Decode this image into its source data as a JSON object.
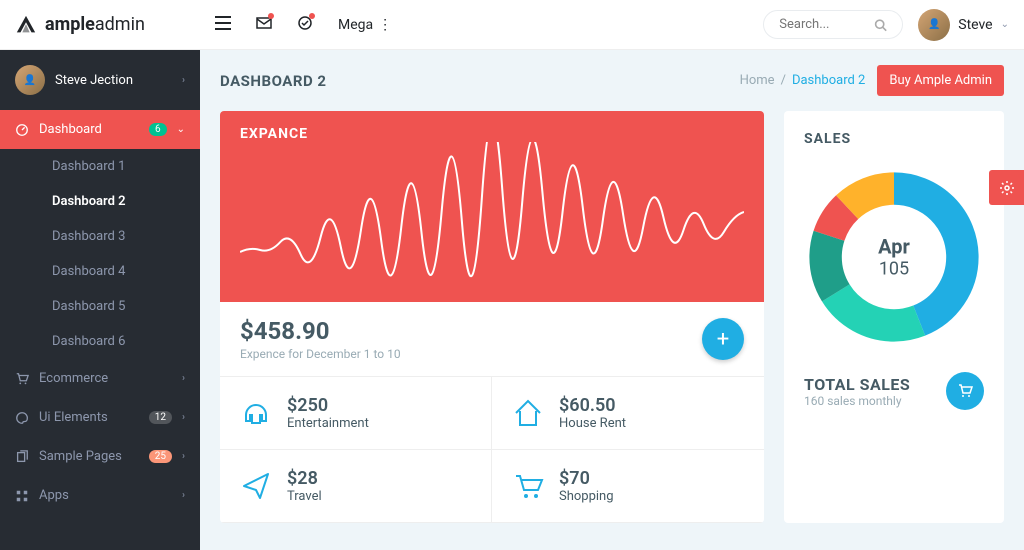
{
  "brand": {
    "bold": "ample",
    "light": "admin"
  },
  "topbar": {
    "mega_label": "Mega",
    "search_placeholder": "Search...",
    "user_name": "Steve"
  },
  "sidebar": {
    "user_name": "Steve Jection",
    "dashboard_label": "Dashboard",
    "dashboard_badge": "6",
    "sub": [
      {
        "label": "Dashboard 1"
      },
      {
        "label": "Dashboard 2"
      },
      {
        "label": "Dashboard 3"
      },
      {
        "label": "Dashboard 4"
      },
      {
        "label": "Dashboard 5"
      },
      {
        "label": "Dashboard 6"
      }
    ],
    "items": [
      {
        "label": "Ecommerce",
        "badge": ""
      },
      {
        "label": "Ui Elements",
        "badge": "12"
      },
      {
        "label": "Sample Pages",
        "badge": "25"
      },
      {
        "label": "Apps",
        "badge": ""
      }
    ]
  },
  "page": {
    "title": "DASHBOARD 2",
    "breadcrumb_home": "Home",
    "breadcrumb_current": "Dashboard 2",
    "buy_button": "Buy Ample Admin"
  },
  "expance": {
    "title": "EXPANCE",
    "total": "$458.90",
    "subtitle": "Expence for December 1 to 10",
    "items": [
      {
        "amount": "$250",
        "label": "Entertainment"
      },
      {
        "amount": "$60.50",
        "label": "House Rent"
      },
      {
        "amount": "$28",
        "label": "Travel"
      },
      {
        "amount": "$70",
        "label": "Shopping"
      }
    ]
  },
  "sales": {
    "title": "SALES",
    "center_label": "Apr",
    "center_value": "105",
    "total_title": "TOTAL SALES",
    "total_sub": "160 sales monthly"
  },
  "chart_data": [
    {
      "type": "line",
      "title": "EXPANCE",
      "x": [
        0,
        5,
        10,
        15,
        20,
        25,
        30,
        35,
        40,
        45,
        50,
        55,
        60,
        65,
        70,
        75,
        80,
        85,
        90,
        95,
        100
      ],
      "values": [
        40,
        42,
        38,
        44,
        47,
        45,
        50,
        53,
        56,
        60,
        65,
        63,
        58,
        55,
        52,
        50,
        48,
        46,
        45,
        43,
        47
      ],
      "ylim": [
        30,
        70
      ]
    },
    {
      "type": "pie",
      "title": "SALES",
      "categories": [
        "Blue",
        "Green",
        "Teal",
        "Red",
        "Yellow"
      ],
      "values": [
        44,
        22,
        14,
        8,
        12
      ],
      "colors": [
        "#20aee3",
        "#24d2b5",
        "#1f9e89",
        "#ef5350",
        "#ffb22b"
      ],
      "center": "Apr 105"
    }
  ]
}
